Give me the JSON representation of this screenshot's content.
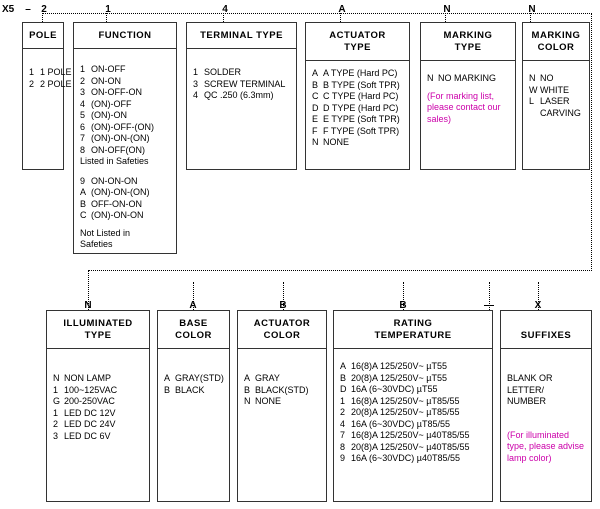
{
  "code": {
    "prefix": "X5",
    "dash1": "–",
    "segments": [
      "2",
      "1",
      "4",
      "A",
      "N",
      "N"
    ],
    "segments2": [
      "N",
      "A",
      "B",
      "B",
      "—",
      "X"
    ]
  },
  "row1": [
    {
      "title": "POLE",
      "rows": [
        {
          "k": "1",
          "v": "1 POLE"
        },
        {
          "k": "2",
          "v": "2 POLE"
        }
      ]
    },
    {
      "title": "FUNCTION",
      "rows": [
        {
          "k": "1",
          "v": "ON-OFF"
        },
        {
          "k": "2",
          "v": "ON-ON"
        },
        {
          "k": "3",
          "v": "ON-OFF-ON"
        },
        {
          "k": "4",
          "v": "(ON)-OFF"
        },
        {
          "k": "5",
          "v": "(ON)-ON"
        },
        {
          "k": "6",
          "v": "(ON)-OFF-(ON)"
        },
        {
          "k": "7",
          "v": "(ON)-ON-(ON)"
        },
        {
          "k": "8",
          "v": "ON-OFF(ON)"
        }
      ],
      "note1": "Listed in Safeties",
      "rows2": [
        {
          "k": "9",
          "v": "ON-ON-ON"
        },
        {
          "k": "A",
          "v": "(ON)-ON-(ON)"
        },
        {
          "k": "B",
          "v": "OFF-ON-ON"
        },
        {
          "k": "C",
          "v": "(ON)-ON-ON"
        }
      ],
      "note2a": "Not Listed in",
      "note2b": "Safeties"
    },
    {
      "title": "TERMINAL TYPE",
      "rows": [
        {
          "k": "1",
          "v": "SOLDER"
        },
        {
          "k": "3",
          "v": "SCREW TERMINAL"
        },
        {
          "k": "4",
          "v": "QC .250  (6.3mm)"
        }
      ]
    },
    {
      "title_l1": "ACTUATOR",
      "title_l2": "TYPE",
      "rows": [
        {
          "k": "A",
          "v": "A TYPE (Hard PC)"
        },
        {
          "k": "B",
          "v": "B TYPE (Soft TPR)"
        },
        {
          "k": "C",
          "v": "C TYPE (Hard PC)"
        },
        {
          "k": "D",
          "v": "D TYPE (Hard PC)"
        },
        {
          "k": "E",
          "v": "E TYPE (Soft TPR)"
        },
        {
          "k": "F",
          "v": "F TYPE (Soft TPR)"
        },
        {
          "k": "N",
          "v": "NONE"
        }
      ]
    },
    {
      "title_l1": "MARKING",
      "title_l2": "TYPE",
      "rows": [
        {
          "k": "N",
          "v": "NO MARKING"
        }
      ],
      "note": [
        "(For marking list,",
        "please contact our",
        "sales)"
      ]
    },
    {
      "title_l1": "MARKING",
      "title_l2": "COLOR",
      "rows": [
        {
          "k": "N",
          "v": "NO"
        },
        {
          "k": "W",
          "v": "WHITE"
        },
        {
          "k": "L",
          "v": "LASER"
        }
      ],
      "extra": "CARVING"
    }
  ],
  "row2": [
    {
      "title_l1": "ILLUMINATED",
      "title_l2": "TYPE",
      "rows": [
        {
          "k": "N",
          "v": "NON LAMP"
        },
        {
          "k": "1",
          "v": "100~125VAC"
        },
        {
          "k": "G",
          "v": "200-250VAC"
        },
        {
          "k": "1",
          "v": "LED  DC 12V"
        },
        {
          "k": "2",
          "v": "LED  DC 24V"
        },
        {
          "k": "3",
          "v": "LED  DC 6V"
        }
      ]
    },
    {
      "title_l1": "BASE",
      "title_l2": "COLOR",
      "rows": [
        {
          "k": "A",
          "v": "GRAY(STD)"
        },
        {
          "k": "B",
          "v": "BLACK"
        }
      ]
    },
    {
      "title_l1": "ACTUATOR",
      "title_l2": "COLOR",
      "rows": [
        {
          "k": "A",
          "v": "GRAY"
        },
        {
          "k": "B",
          "v": "BLACK(STD)"
        },
        {
          "k": "N",
          "v": "NONE"
        }
      ]
    },
    {
      "title_l1": "RATING",
      "title_l2": "TEMPERATURE",
      "rows": [
        {
          "k": "A",
          "v": "16(8)A 125/250V~ µT55"
        },
        {
          "k": "B",
          "v": "20(8)A 125/250V~ µT55"
        },
        {
          "k": "D",
          "v": "16A (6~30VDC) µT55"
        },
        {
          "k": "1",
          "v": "16(8)A 125/250V~ µT85/55"
        },
        {
          "k": "2",
          "v": "20(8)A 125/250V~ µT85/55"
        },
        {
          "k": "4",
          "v": "16A (6~30VDC) µT85/55"
        },
        {
          "k": "7",
          "v": "16(8)A 125/250V~ µ40T85/55"
        },
        {
          "k": "8",
          "v": "20(8)A 125/250V~ µ40T85/55"
        },
        {
          "k": "9",
          "v": "16A (6~30VDC) µ40T85/55"
        }
      ]
    },
    {
      "title": "SUFFIXES",
      "lines": [
        "BLANK OR",
        "LETTER/",
        "NUMBER"
      ],
      "note": [
        "(For illuminated",
        "type, please advise",
        "lamp color)"
      ]
    }
  ]
}
